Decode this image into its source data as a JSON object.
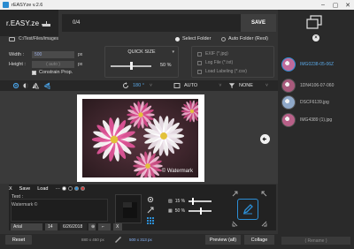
{
  "window": {
    "title": "rEASYze v.2.6"
  },
  "header": {
    "logo_text": "r.EASY.ze",
    "counter": "0/4",
    "save_label": "SAVE"
  },
  "folder": {
    "path": "C:/Test/Files/images",
    "select_label": "Select Folder",
    "auto_label": "Auto Folder (Reol)"
  },
  "settings": {
    "width_label": "Width :",
    "width_value": "500",
    "height_label": "Height :",
    "height_value": "( auto )",
    "unit": "px",
    "constrain_label": "Constrain Prop.",
    "quick_size_label": "QUICK SIZE",
    "quick_size_value": "50 %",
    "quick_size_fraction": 0.5,
    "exif_label": "EXIF (*.jpg)",
    "log_label": "Log File (*.txt)",
    "labeling_label": "Load Labeling (*.csv)"
  },
  "toolbar": {
    "rotation": "180 °",
    "format": "AUTO",
    "filter": "NONE"
  },
  "canvas": {
    "watermark_text": "© Watermark"
  },
  "editor": {
    "tab_x": "X",
    "tab_save": "Save",
    "tab_load": "Load",
    "tab_more": "···",
    "text_label": "Text :",
    "text_value": "Watermark ©",
    "font": "Arial",
    "font_size": "14",
    "date": "6/26/2018",
    "clear": "X",
    "opacity_value": "15 %",
    "size_value": "50 %",
    "opacity_fraction": 0.15,
    "size_fraction": 0.5
  },
  "bottom": {
    "reset_label": "Reset",
    "orig_dims": "880 x 450 px",
    "new_dims": "500 x 313 px",
    "preview_label": "Preview (all)",
    "collage_label": "Collage"
  },
  "sidebar": {
    "files": [
      {
        "name": "IMG0238-05-06Z",
        "selected": true
      },
      {
        "name": "1DN4106-07-060",
        "selected": false
      },
      {
        "name": "DSCF6139.jpg",
        "selected": false
      },
      {
        "name": "IMG4389 (1).jpg",
        "selected": false
      }
    ],
    "rename_label": "( Rename )"
  },
  "colors": {
    "accent": "#2c8fd6",
    "background": "#333333"
  }
}
